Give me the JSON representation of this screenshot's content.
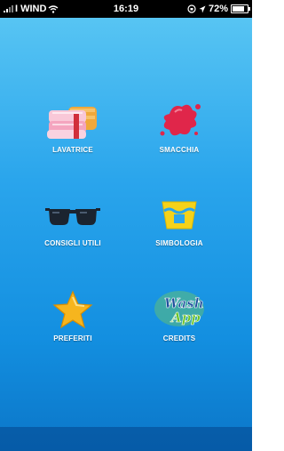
{
  "status_bar": {
    "carrier": "I WIND",
    "time": "16:19",
    "battery": "72%",
    "battery_level": 0.72,
    "icons": [
      "signal-icon",
      "wifi-icon",
      "lock-rotation-icon",
      "location-icon",
      "battery-icon"
    ]
  },
  "menu": {
    "items": [
      {
        "label": "LAVATRICE",
        "icon": "towels-icon"
      },
      {
        "label": "SMACCHIA",
        "icon": "stain-icon"
      },
      {
        "label": "CONSIGLI UTILI",
        "icon": "glasses-icon"
      },
      {
        "label": "SIMBOLOGIA",
        "icon": "wash-tub-icon"
      },
      {
        "label": "PREFERITI",
        "icon": "star-icon"
      },
      {
        "label": "CREDITS",
        "icon": "washapp-logo",
        "logo_text": "Wash App"
      }
    ]
  },
  "colors": {
    "background_top": "#5cc8f4",
    "background_bottom": "#0b76c8",
    "label": "#ffffff"
  }
}
